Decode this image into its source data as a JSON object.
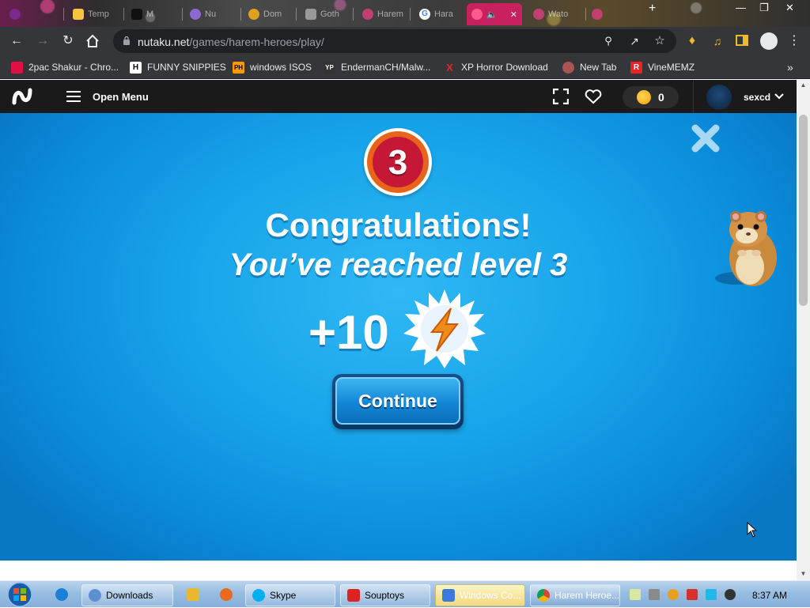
{
  "browser": {
    "tabs": [
      {
        "label": ""
      },
      {
        "label": "Temp"
      },
      {
        "label": "M"
      },
      {
        "label": "Nu"
      },
      {
        "label": "Dom"
      },
      {
        "label": "Goth"
      },
      {
        "label": "Harem"
      },
      {
        "label": "Hara"
      },
      {
        "label": ""
      },
      {
        "label": "Wato"
      }
    ],
    "new_tab": "+",
    "url_domain": "nutaku.net",
    "url_path": "/games/harem-heroes/play/",
    "bookmarks": [
      {
        "label": "2pac Shakur - Chro...",
        "icon": "2pac-icon"
      },
      {
        "label": "FUNNY SNIPPIES",
        "icon": "H"
      },
      {
        "label": "windows ISOS",
        "icon": "PH"
      },
      {
        "label": "EndermanCH/Malw...",
        "icon": "YP"
      },
      {
        "label": "XP Horror Download",
        "icon": "X"
      },
      {
        "label": "New Tab",
        "icon": "new-tab-icon"
      },
      {
        "label": "VineMEMZ",
        "icon": "R"
      }
    ],
    "bookmarks_overflow": "»"
  },
  "site_header": {
    "menu_label": "Open Menu",
    "coins": "0",
    "username": "sexcd"
  },
  "game": {
    "level": "3",
    "title_line1": "Congratulations!",
    "title_line2": "You’ve reached level 3",
    "reward": "+10",
    "continue_label": "Continue"
  },
  "taskbar": {
    "items": [
      {
        "label": "Downloads"
      },
      {
        "label": "Skype"
      },
      {
        "label": "Souptoys"
      },
      {
        "label": "Windows Co..."
      },
      {
        "label": "Harem Heroe..."
      }
    ],
    "clock": "8:37 AM"
  },
  "colors": {
    "game_blue": "#18a4ea",
    "active_tab": "#c9205f",
    "header_bg": "#1a1a1a",
    "badge_red": "#c41836",
    "badge_orange": "#e8641b"
  }
}
